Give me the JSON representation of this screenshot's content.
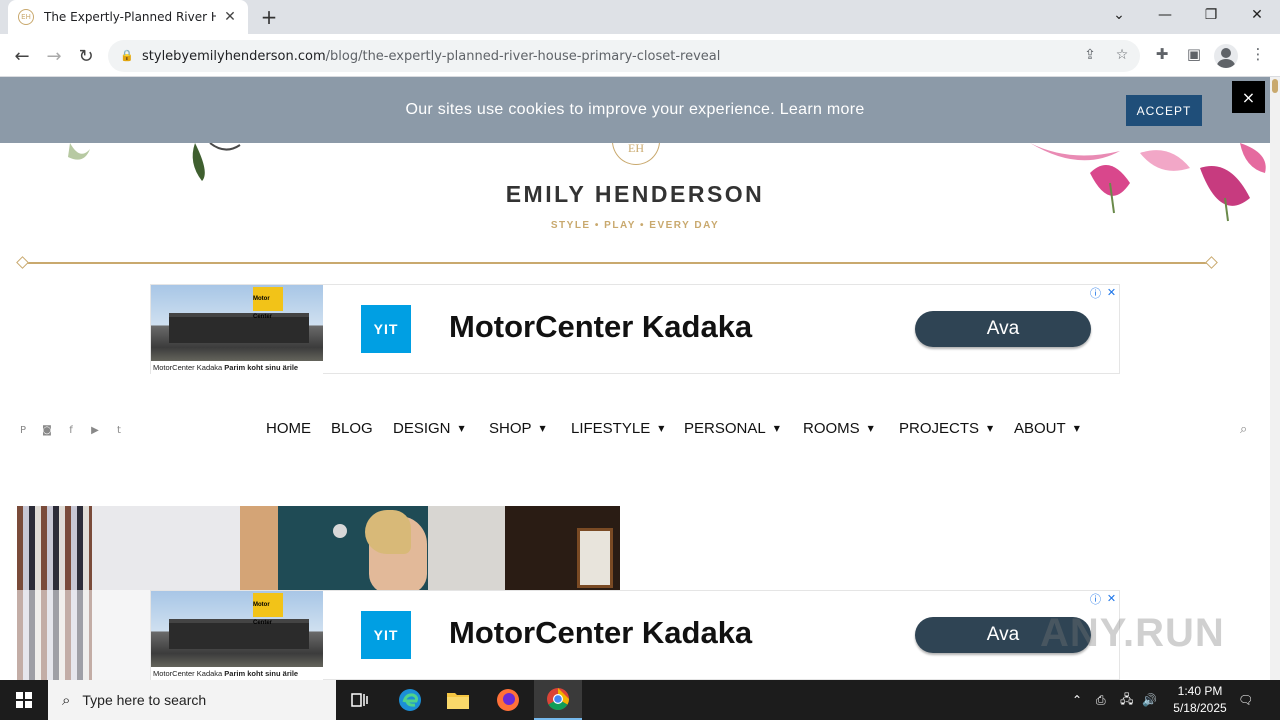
{
  "browser": {
    "tab_title": "The Expertly-Planned River Hou",
    "url_host": "stylebyemilyhenderson.com",
    "url_path": "/blog/the-expertly-planned-river-house-primary-closet-reveal"
  },
  "cookie_banner": {
    "text": "Our sites use cookies to improve your experience. Learn more",
    "accept_label": "ACCEPT",
    "close_label": "×"
  },
  "header": {
    "logo_mark": "EH",
    "site_name": "EMILY HENDERSON",
    "tagline": "STYLE   •   PLAY   •   EVERY DAY"
  },
  "ad": {
    "caption_brand": "MotorCenter Kadaka",
    "caption_text": "Parim koht sinu ärile",
    "sign_text": "Motor Center",
    "logo": "YIT",
    "title": "MotorCenter Kadaka",
    "button": "Ava"
  },
  "nav": {
    "items": [
      {
        "label": "HOME",
        "caret": false
      },
      {
        "label": "BLOG",
        "caret": false
      },
      {
        "label": "DESIGN",
        "caret": true
      },
      {
        "label": "SHOP",
        "caret": true
      },
      {
        "label": "LIFESTYLE",
        "caret": true
      },
      {
        "label": "PERSONAL",
        "caret": true
      },
      {
        "label": "ROOMS",
        "caret": true
      },
      {
        "label": "PROJECTS",
        "caret": true
      },
      {
        "label": "ABOUT",
        "caret": true
      }
    ],
    "caret_glyph": "▼"
  },
  "social": {
    "pinterest": "P",
    "instagram": "◙",
    "facebook": "f",
    "youtube": "▶",
    "twitter": "t"
  },
  "watermark": "ANY.RUN",
  "taskbar": {
    "search_placeholder": "Type here to search",
    "time": "1:40 PM",
    "date": "5/18/2025"
  }
}
